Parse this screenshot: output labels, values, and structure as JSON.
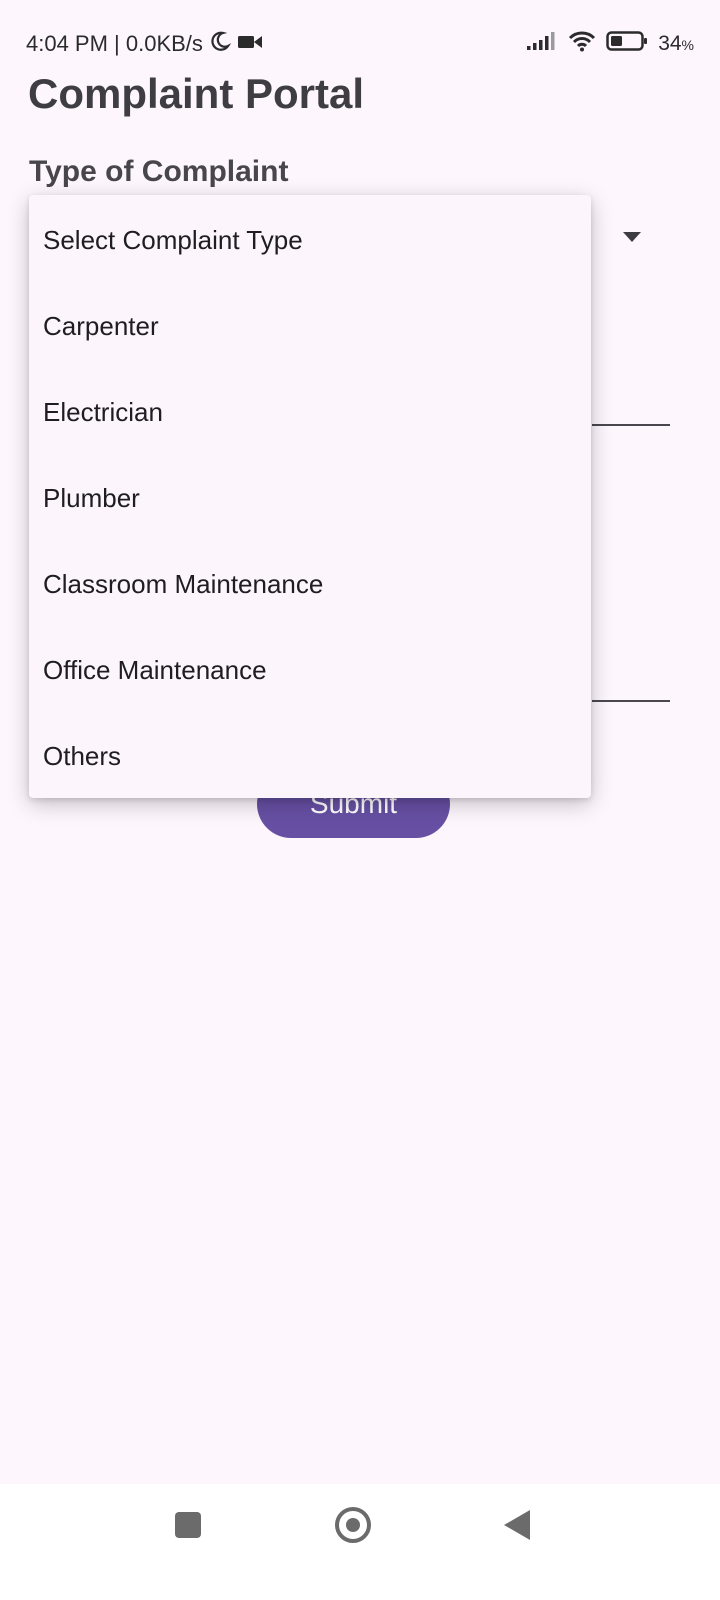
{
  "status_bar": {
    "time_speed": "4:04 PM | 0.0KB/s",
    "battery": "34",
    "battery_unit": "%",
    "icons": [
      "moon-icon",
      "video-camera-icon",
      "signal-icon",
      "wifi-icon",
      "battery-icon"
    ]
  },
  "page": {
    "title": "Complaint Portal",
    "field_label": "Type of Complaint"
  },
  "complaint_type_menu": {
    "options": [
      "Select Complaint Type",
      "Carpenter",
      "Electrician",
      "Plumber",
      "Classroom Maintenance",
      "Office Maintenance",
      "Others"
    ]
  },
  "submit": {
    "label": "Submit"
  },
  "nav_bar": {
    "icons": [
      "recents-square-icon",
      "home-circle-icon",
      "back-triangle-icon"
    ]
  },
  "colors": {
    "background": "#fdf6fd",
    "accent": "#6750a4",
    "menu_background": "#fcf6fc"
  }
}
